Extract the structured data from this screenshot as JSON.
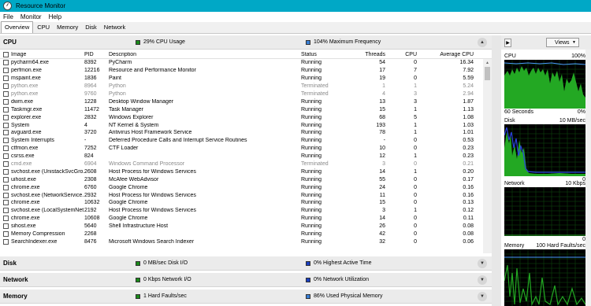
{
  "window": {
    "title": "Resource Monitor"
  },
  "menu": [
    "File",
    "Monitor",
    "Help"
  ],
  "tabs": [
    "Overview",
    "CPU",
    "Memory",
    "Disk",
    "Network"
  ],
  "cpu_section": {
    "title": "CPU",
    "stat1": "29% CPU Usage",
    "stat1_color": "#1a8a1a",
    "stat2": "104% Maximum Frequency",
    "stat2_color": "#3a7fd5",
    "columns": {
      "image": "Image",
      "pid": "PID",
      "description": "Description",
      "status": "Status",
      "threads": "Threads",
      "cpu": "CPU",
      "avg_cpu": "Average CPU"
    },
    "rows": [
      {
        "image": "pycharm64.exe",
        "pid": "8392",
        "description": "PyCharm",
        "status": "Running",
        "threads": "54",
        "cpu": "0",
        "avg_cpu": "16.34",
        "terminated": false
      },
      {
        "image": "perfmon.exe",
        "pid": "12216",
        "description": "Resource and Performance Monitor",
        "status": "Running",
        "threads": "17",
        "cpu": "7",
        "avg_cpu": "7.92",
        "terminated": false
      },
      {
        "image": "mspaint.exe",
        "pid": "1836",
        "description": "Paint",
        "status": "Running",
        "threads": "19",
        "cpu": "0",
        "avg_cpu": "5.59",
        "terminated": false
      },
      {
        "image": "python.exe",
        "pid": "8964",
        "description": "Python",
        "status": "Terminated",
        "threads": "1",
        "cpu": "1",
        "avg_cpu": "5.24",
        "terminated": true
      },
      {
        "image": "python.exe",
        "pid": "9760",
        "description": "Python",
        "status": "Terminated",
        "threads": "4",
        "cpu": "3",
        "avg_cpu": "2.94",
        "terminated": true
      },
      {
        "image": "dwm.exe",
        "pid": "1228",
        "description": "Desktop Window Manager",
        "status": "Running",
        "threads": "13",
        "cpu": "3",
        "avg_cpu": "1.87",
        "terminated": false
      },
      {
        "image": "Taskmgr.exe",
        "pid": "11472",
        "description": "Task Manager",
        "status": "Running",
        "threads": "15",
        "cpu": "1",
        "avg_cpu": "1.13",
        "terminated": false
      },
      {
        "image": "explorer.exe",
        "pid": "2832",
        "description": "Windows Explorer",
        "status": "Running",
        "threads": "68",
        "cpu": "5",
        "avg_cpu": "1.08",
        "terminated": false
      },
      {
        "image": "System",
        "pid": "4",
        "description": "NT Kernel & System",
        "status": "Running",
        "threads": "193",
        "cpu": "1",
        "avg_cpu": "1.03",
        "terminated": false
      },
      {
        "image": "avguard.exe",
        "pid": "3720",
        "description": "Antivirus Host Framework Service",
        "status": "Running",
        "threads": "78",
        "cpu": "1",
        "avg_cpu": "1.01",
        "terminated": false
      },
      {
        "image": "System Interrupts",
        "pid": "-",
        "description": "Deferred Procedure Calls and Interrupt Service Routines",
        "status": "Running",
        "threads": "-",
        "cpu": "0",
        "avg_cpu": "0.53",
        "terminated": false
      },
      {
        "image": "ctfmon.exe",
        "pid": "7252",
        "description": "CTF Loader",
        "status": "Running",
        "threads": "10",
        "cpu": "0",
        "avg_cpu": "0.23",
        "terminated": false
      },
      {
        "image": "csrss.exe",
        "pid": "824",
        "description": "",
        "status": "Running",
        "threads": "12",
        "cpu": "1",
        "avg_cpu": "0.23",
        "terminated": false
      },
      {
        "image": "cmd.exe",
        "pid": "6904",
        "description": "Windows Command Processor",
        "status": "Terminated",
        "threads": "3",
        "cpu": "0",
        "avg_cpu": "0.21",
        "terminated": true
      },
      {
        "image": "svchost.exe (UnistackSvcGro...",
        "pid": "2608",
        "description": "Host Process for Windows Services",
        "status": "Running",
        "threads": "14",
        "cpu": "1",
        "avg_cpu": "0.20",
        "terminated": false
      },
      {
        "image": "uihost.exe",
        "pid": "2308",
        "description": "McAfee WebAdvisor",
        "status": "Running",
        "threads": "55",
        "cpu": "0",
        "avg_cpu": "0.17",
        "terminated": false
      },
      {
        "image": "chrome.exe",
        "pid": "6760",
        "description": "Google Chrome",
        "status": "Running",
        "threads": "24",
        "cpu": "0",
        "avg_cpu": "0.16",
        "terminated": false
      },
      {
        "image": "svchost.exe (NetworkService...",
        "pid": "2932",
        "description": "Host Process for Windows Services",
        "status": "Running",
        "threads": "11",
        "cpu": "0",
        "avg_cpu": "0.16",
        "terminated": false
      },
      {
        "image": "chrome.exe",
        "pid": "10632",
        "description": "Google Chrome",
        "status": "Running",
        "threads": "15",
        "cpu": "0",
        "avg_cpu": "0.13",
        "terminated": false
      },
      {
        "image": "svchost.exe (LocalSystemNet...",
        "pid": "2192",
        "description": "Host Process for Windows Services",
        "status": "Running",
        "threads": "3",
        "cpu": "1",
        "avg_cpu": "0.12",
        "terminated": false
      },
      {
        "image": "chrome.exe",
        "pid": "10608",
        "description": "Google Chrome",
        "status": "Running",
        "threads": "14",
        "cpu": "0",
        "avg_cpu": "0.11",
        "terminated": false
      },
      {
        "image": "sihost.exe",
        "pid": "5640",
        "description": "Shell Infrastructure Host",
        "status": "Running",
        "threads": "26",
        "cpu": "0",
        "avg_cpu": "0.08",
        "terminated": false
      },
      {
        "image": "Memory Compression",
        "pid": "2268",
        "description": "",
        "status": "Running",
        "threads": "42",
        "cpu": "0",
        "avg_cpu": "0.08",
        "terminated": false
      },
      {
        "image": "SearchIndexer.exe",
        "pid": "8476",
        "description": "Microsoft Windows Search Indexer",
        "status": "Running",
        "threads": "32",
        "cpu": "0",
        "avg_cpu": "0.06",
        "terminated": false
      }
    ]
  },
  "disk_section": {
    "title": "Disk",
    "stat1": "0 MB/sec Disk I/O",
    "stat1_color": "#1a8a1a",
    "stat2": "0% Highest Active Time",
    "stat2_color": "#1a3fc0"
  },
  "network_section": {
    "title": "Network",
    "stat1": "0 Kbps Network I/O",
    "stat1_color": "#1a8a1a",
    "stat2": "0% Network Utilization",
    "stat2_color": "#1a3fc0"
  },
  "memory_section": {
    "title": "Memory",
    "stat1": "1 Hard Faults/sec",
    "stat1_color": "#1a8a1a",
    "stat2": "86% Used Physical Memory",
    "stat2_color": "#3a7fd5"
  },
  "right_panel": {
    "views_label": "Views",
    "cpu_graph": {
      "label": "CPU",
      "max": "100%",
      "bottom_left": "60 Seconds",
      "bottom_right": "0%"
    },
    "disk_graph": {
      "label": "Disk",
      "max": "10 MB/sec",
      "bottom_right": "0"
    },
    "network_graph": {
      "label": "Network",
      "max": "10 Kbps",
      "bottom_right": "0"
    },
    "memory_graph": {
      "label": "Memory",
      "max": "100 Hard Faults/sec"
    }
  }
}
